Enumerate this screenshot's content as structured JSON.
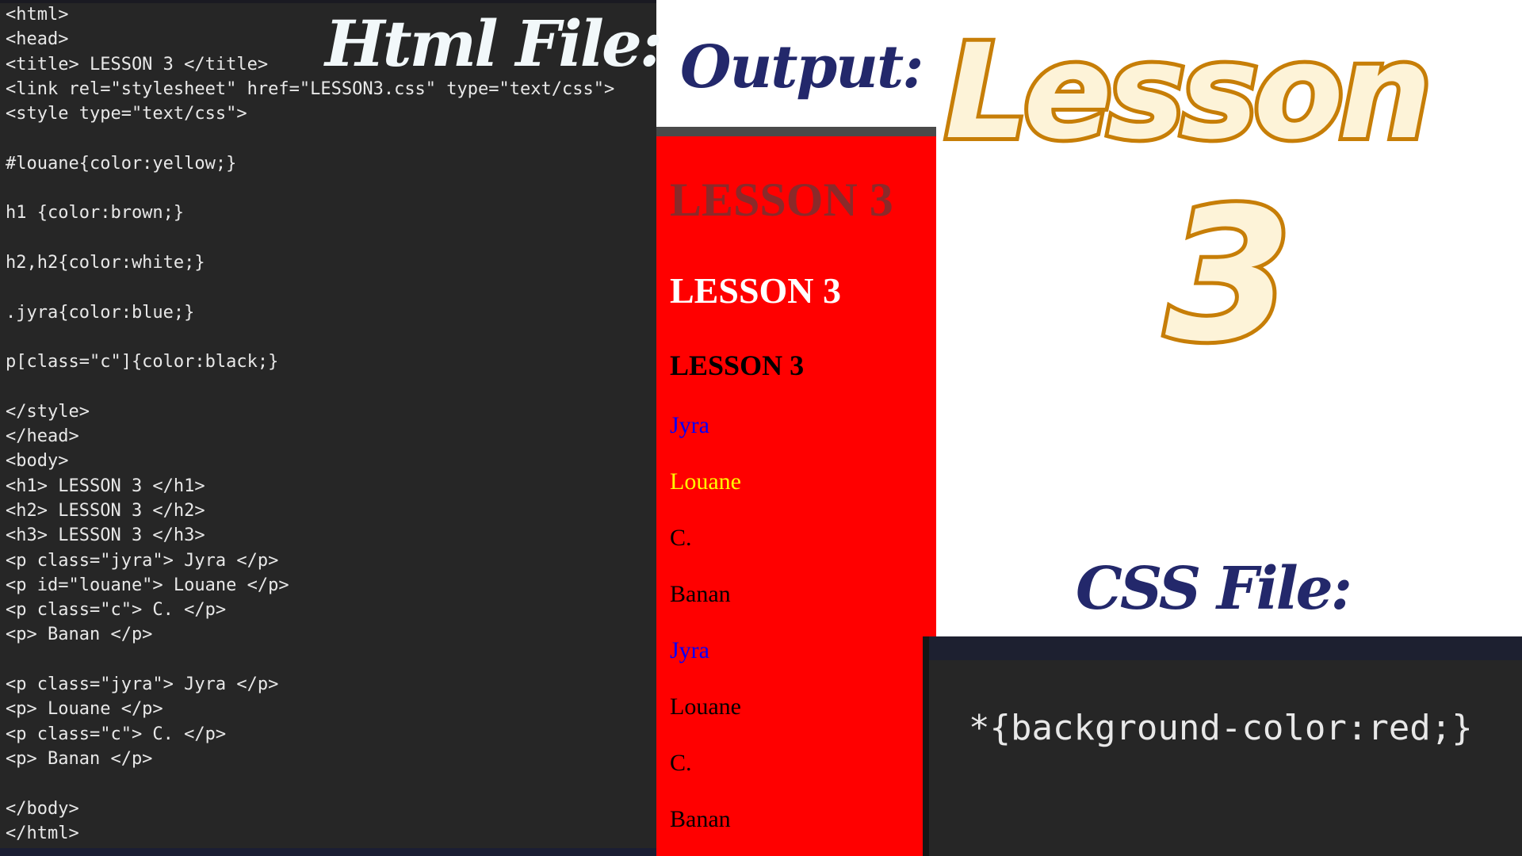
{
  "html_panel": {
    "title": "Html File:",
    "lines": [
      "<html>",
      "<head>",
      "<title> LESSON 3 </title>",
      "<link rel=\"stylesheet\" href=\"LESSON3.css\" type=\"text/css\">",
      "<style type=\"text/css\">",
      "",
      "#louane{color:yellow;}",
      "",
      "h1 {color:brown;}",
      "",
      "h2,h2{color:white;}",
      "",
      ".jyra{color:blue;}",
      "",
      "p[class=\"c\"]{color:black;}",
      "",
      "</style>",
      "</head>",
      "<body>",
      "<h1> LESSON 3 </h1>",
      "<h2> LESSON 3 </h2>",
      "<h3> LESSON 3 </h3>",
      "<p class=\"jyra\"> Jyra </p>",
      "<p id=\"louane\"> Louane </p>",
      "<p class=\"c\"> C. </p>",
      "<p> Banan </p>",
      "",
      "<p class=\"jyra\"> Jyra </p>",
      "<p> Louane </p>",
      "<p class=\"c\"> C. </p>",
      "<p> Banan </p>",
      "",
      "</body>",
      "</html>"
    ]
  },
  "output_panel": {
    "title": "Output:",
    "background_color": "#ff0000",
    "h1": "LESSON 3",
    "h2": "LESSON 3",
    "h3": "LESSON 3",
    "paragraphs": [
      "Jyra",
      "Louane",
      "C.",
      "Banan",
      "Jyra",
      "Louane",
      "C.",
      "Banan"
    ]
  },
  "banner": {
    "word": "Lesson",
    "number": "3"
  },
  "css_panel": {
    "title": "CSS File:",
    "code": "*{background-color:red;}"
  }
}
